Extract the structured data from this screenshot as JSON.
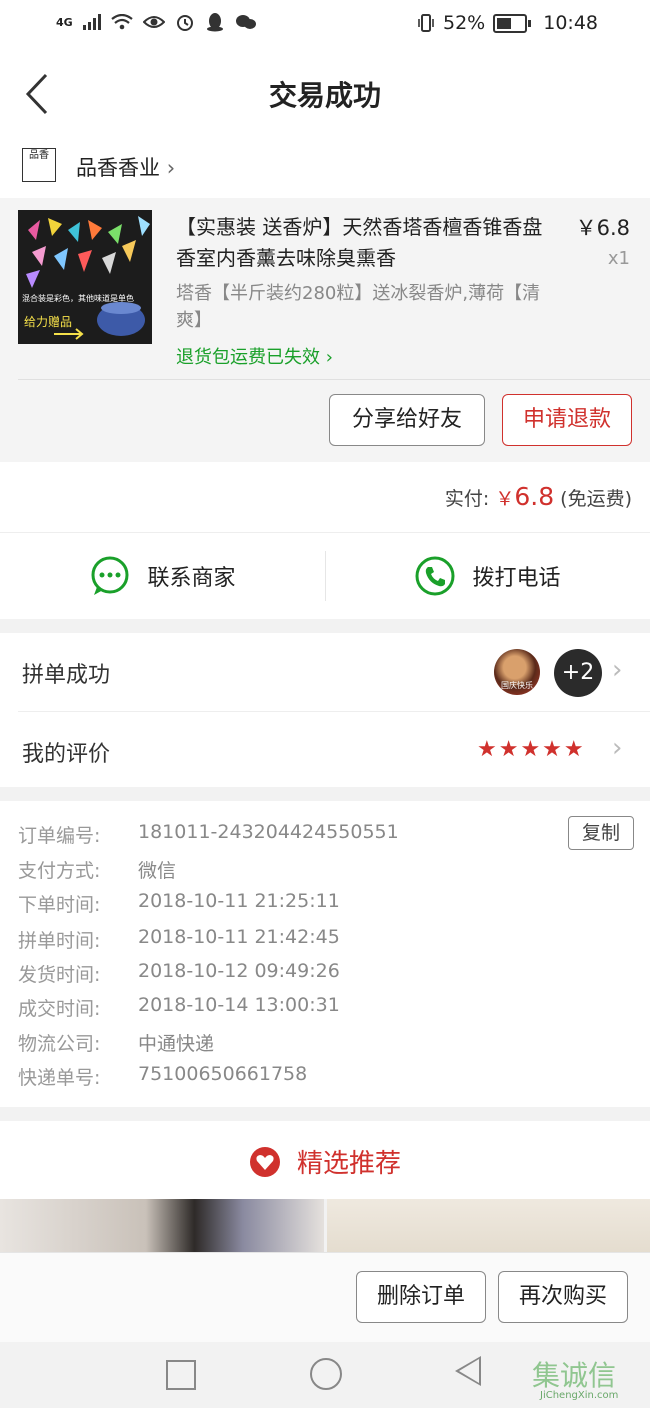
{
  "status": {
    "network": "4G",
    "battery": "52%",
    "time": "10:48"
  },
  "nav": {
    "title": "交易成功"
  },
  "shop": {
    "name": "品香香业",
    "logo_text": "品香"
  },
  "product": {
    "title": "【实惠装 送香炉】天然香塔香檀香锥香盘香室内香薰去味除臭熏香",
    "spec": "塔香【半斤装约280粒】送冰裂香炉,薄荷【清爽】",
    "refund_note": "退货包运费已失效",
    "price": "￥6.8",
    "qty": "x1",
    "image_caption_1": "混合装是彩色，其他味道是单色",
    "image_caption_2": "给力赠品",
    "share_label": "分享给好友",
    "refund_label": "申请退款"
  },
  "payment": {
    "label": "实付:",
    "currency": "￥",
    "amount": "6.8",
    "shipping": "(免运费)"
  },
  "contact": {
    "merchant": "联系商家",
    "phone": "拨打电话"
  },
  "group": {
    "label": "拼单成功",
    "extra_count": "+2",
    "avatar_caption": "国庆快乐"
  },
  "rating": {
    "label": "我的评价",
    "stars": "★★★★★",
    "value": 5
  },
  "order_info": {
    "copy_label": "复制",
    "rows": [
      {
        "label": "订单编号:",
        "value": "181011-243204424550551"
      },
      {
        "label": "支付方式:",
        "value": "微信"
      },
      {
        "label": "下单时间:",
        "value": "2018-10-11 21:25:11"
      },
      {
        "label": "拼单时间:",
        "value": "2018-10-11 21:42:45"
      },
      {
        "label": "发货时间:",
        "value": "2018-10-12 09:49:26"
      },
      {
        "label": "成交时间:",
        "value": "2018-10-14 13:00:31"
      },
      {
        "label": "物流公司:",
        "value": "中通快递"
      },
      {
        "label": "快递单号:",
        "value": "75100650661758"
      }
    ]
  },
  "recommend": {
    "title": "精选推荐"
  },
  "actions": {
    "delete_label": "删除订单",
    "rebuy_label": "再次购买"
  },
  "watermark": {
    "text": "集诚信",
    "url_text": "JiChengXin.com"
  },
  "colors": {
    "accent": "#d0312d",
    "green": "#1aa02a"
  }
}
